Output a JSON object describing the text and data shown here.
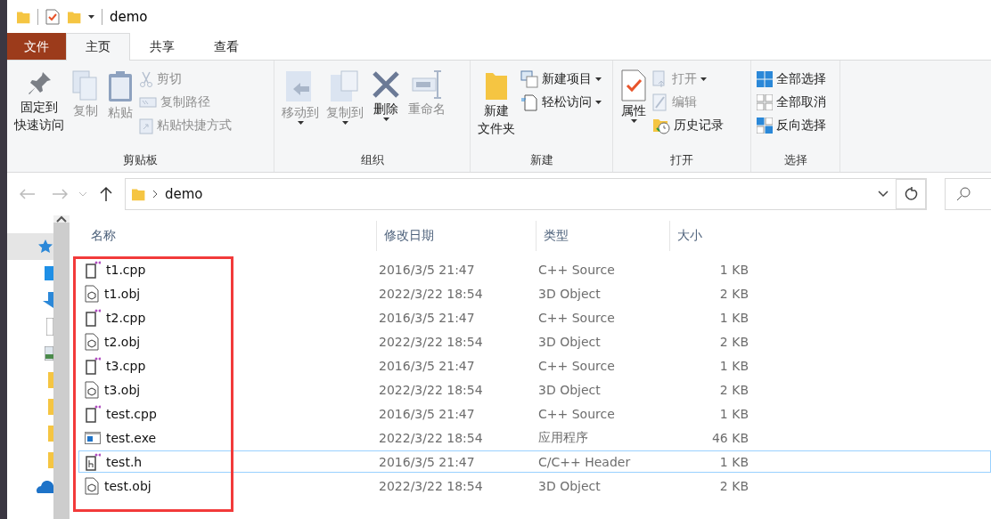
{
  "window": {
    "title": "demo"
  },
  "tabs": [
    {
      "label": "文件",
      "kind": "file",
      "selected": false
    },
    {
      "label": "主页",
      "kind": "tab",
      "selected": true
    },
    {
      "label": "共享",
      "kind": "tab",
      "selected": false
    },
    {
      "label": "查看",
      "kind": "tab",
      "selected": false
    }
  ],
  "ribbon": {
    "groups": [
      {
        "label": "剪贴板",
        "items": [
          {
            "kind": "large",
            "lines": [
              "固定到",
              "快速访问"
            ],
            "disabled": false,
            "dropdown": false
          },
          {
            "kind": "large",
            "lines": [
              "复制"
            ],
            "disabled": true,
            "dropdown": false
          },
          {
            "kind": "large",
            "lines": [
              "粘贴"
            ],
            "disabled": true,
            "dropdown": false
          },
          {
            "kind": "small",
            "label": "剪切",
            "disabled": true,
            "dropdown": false
          },
          {
            "kind": "small",
            "label": "复制路径",
            "disabled": true,
            "dropdown": false
          },
          {
            "kind": "small",
            "label": "粘贴快捷方式",
            "disabled": true,
            "dropdown": false
          }
        ]
      },
      {
        "label": "组织",
        "items": [
          {
            "kind": "large",
            "lines": [
              "移动到"
            ],
            "disabled": true,
            "dropdown": true
          },
          {
            "kind": "large",
            "lines": [
              "复制到"
            ],
            "disabled": true,
            "dropdown": true
          },
          {
            "kind": "large",
            "lines": [
              "删除"
            ],
            "disabled": false,
            "dropdown": true
          },
          {
            "kind": "large",
            "lines": [
              "重命名"
            ],
            "disabled": true,
            "dropdown": false
          }
        ]
      },
      {
        "label": "新建",
        "items": [
          {
            "kind": "large",
            "lines": [
              "新建",
              "文件夹"
            ],
            "disabled": false,
            "dropdown": false
          },
          {
            "kind": "small",
            "label": "新建项目",
            "disabled": false,
            "dropdown": true
          },
          {
            "kind": "small",
            "label": "轻松访问",
            "disabled": false,
            "dropdown": true
          }
        ]
      },
      {
        "label": "打开",
        "items": [
          {
            "kind": "large",
            "lines": [
              "属性"
            ],
            "disabled": false,
            "dropdown": true
          },
          {
            "kind": "small",
            "label": "打开",
            "disabled": true,
            "dropdown": true
          },
          {
            "kind": "small",
            "label": "编辑",
            "disabled": true,
            "dropdown": false
          },
          {
            "kind": "small",
            "label": "历史记录",
            "disabled": false,
            "dropdown": false
          }
        ]
      },
      {
        "label": "选择",
        "items": [
          {
            "kind": "small",
            "label": "全部选择",
            "disabled": false,
            "dropdown": false
          },
          {
            "kind": "small",
            "label": "全部取消",
            "disabled": false,
            "dropdown": false
          },
          {
            "kind": "small",
            "label": "反向选择",
            "disabled": false,
            "dropdown": false
          }
        ]
      }
    ]
  },
  "address_bar": {
    "path": "demo"
  },
  "nav_pane": {
    "items": [
      {
        "selected": true
      },
      {
        "selected": false
      },
      {
        "selected": false
      },
      {
        "selected": false
      },
      {
        "selected": false
      },
      {
        "selected": false
      },
      {
        "selected": false
      },
      {
        "selected": false
      },
      {
        "selected": false
      },
      {
        "selected": false
      }
    ]
  },
  "table": {
    "columns": [
      "名称",
      "修改日期",
      "类型",
      "大小"
    ],
    "rows": [
      {
        "kind": "cpp",
        "name": "t1.cpp",
        "date": "2016/3/5 21:47",
        "type": "C++ Source",
        "size": "1 KB",
        "focused": false
      },
      {
        "kind": "obj",
        "name": "t1.obj",
        "date": "2022/3/22 18:54",
        "type": "3D Object",
        "size": "2 KB",
        "focused": false
      },
      {
        "kind": "cpp",
        "name": "t2.cpp",
        "date": "2016/3/5 21:47",
        "type": "C++ Source",
        "size": "1 KB",
        "focused": false
      },
      {
        "kind": "obj",
        "name": "t2.obj",
        "date": "2022/3/22 18:54",
        "type": "3D Object",
        "size": "2 KB",
        "focused": false
      },
      {
        "kind": "cpp",
        "name": "t3.cpp",
        "date": "2016/3/5 21:47",
        "type": "C++ Source",
        "size": "1 KB",
        "focused": false
      },
      {
        "kind": "obj",
        "name": "t3.obj",
        "date": "2022/3/22 18:54",
        "type": "3D Object",
        "size": "2 KB",
        "focused": false
      },
      {
        "kind": "cpp",
        "name": "test.cpp",
        "date": "2016/3/5 21:47",
        "type": "C++ Source",
        "size": "1 KB",
        "focused": false
      },
      {
        "kind": "exe",
        "name": "test.exe",
        "date": "2022/3/22 18:54",
        "type": "应用程序",
        "size": "46 KB",
        "focused": false
      },
      {
        "kind": "h",
        "name": "test.h",
        "date": "2016/3/5 21:47",
        "type": "C/C++ Header",
        "size": "1 KB",
        "focused": true
      },
      {
        "kind": "obj",
        "name": "test.obj",
        "date": "2022/3/22 18:54",
        "type": "3D Object",
        "size": "2 KB",
        "focused": false
      }
    ]
  }
}
